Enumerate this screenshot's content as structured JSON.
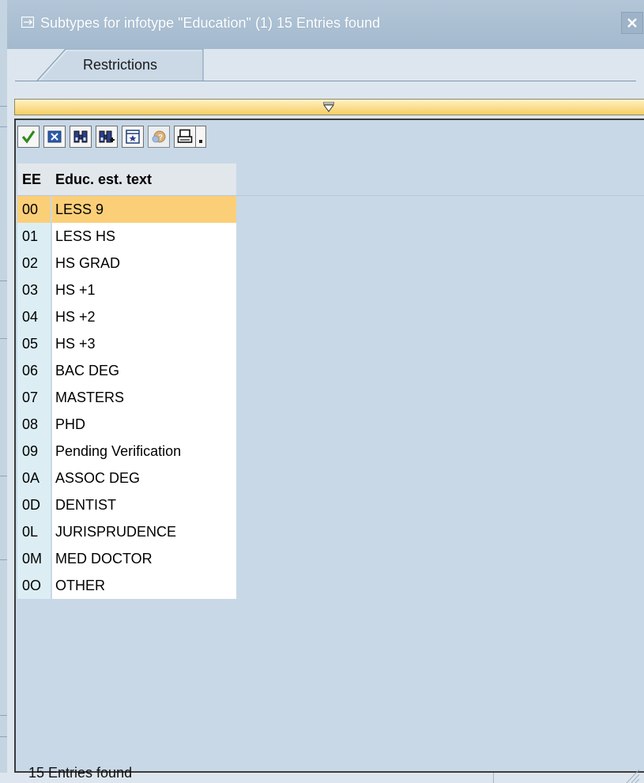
{
  "window": {
    "title": "Subtypes for infotype \"Education\" (1)   15 Entries found"
  },
  "tabs": [
    {
      "label": "Restrictions"
    }
  ],
  "toolbar": {
    "buttons": [
      {
        "icon": "checkmark-icon"
      },
      {
        "icon": "cancel-icon"
      },
      {
        "icon": "find-icon"
      },
      {
        "icon": "find-next-icon"
      },
      {
        "icon": "select-all-icon"
      },
      {
        "icon": "help-icon"
      },
      {
        "icon": "print-icon"
      }
    ]
  },
  "table": {
    "columns": [
      "EE",
      "Educ. est. text"
    ],
    "rows": [
      {
        "key": "00",
        "text": "LESS 9",
        "selected": true
      },
      {
        "key": "01",
        "text": "LESS HS"
      },
      {
        "key": "02",
        "text": "HS GRAD"
      },
      {
        "key": "03",
        "text": "HS +1"
      },
      {
        "key": "04",
        "text": "HS +2"
      },
      {
        "key": "05",
        "text": "HS +3"
      },
      {
        "key": "06",
        "text": "BAC DEG"
      },
      {
        "key": "07",
        "text": "MASTERS"
      },
      {
        "key": "08",
        "text": "PHD"
      },
      {
        "key": "09",
        "text": "Pending Verification"
      },
      {
        "key": "0A",
        "text": "ASSOC DEG"
      },
      {
        "key": "0D",
        "text": "DENTIST"
      },
      {
        "key": "0L",
        "text": "JURISPRUDENCE"
      },
      {
        "key": "0M",
        "text": "MED DOCTOR"
      },
      {
        "key": "0O",
        "text": "OTHER"
      }
    ]
  },
  "status": {
    "text": "15 Entries found"
  },
  "colors": {
    "selected_row": "#fbcf78",
    "key_column": "#dceef4",
    "pane_background": "#c8d8e6",
    "criteria_bar": "#f6cd62"
  }
}
